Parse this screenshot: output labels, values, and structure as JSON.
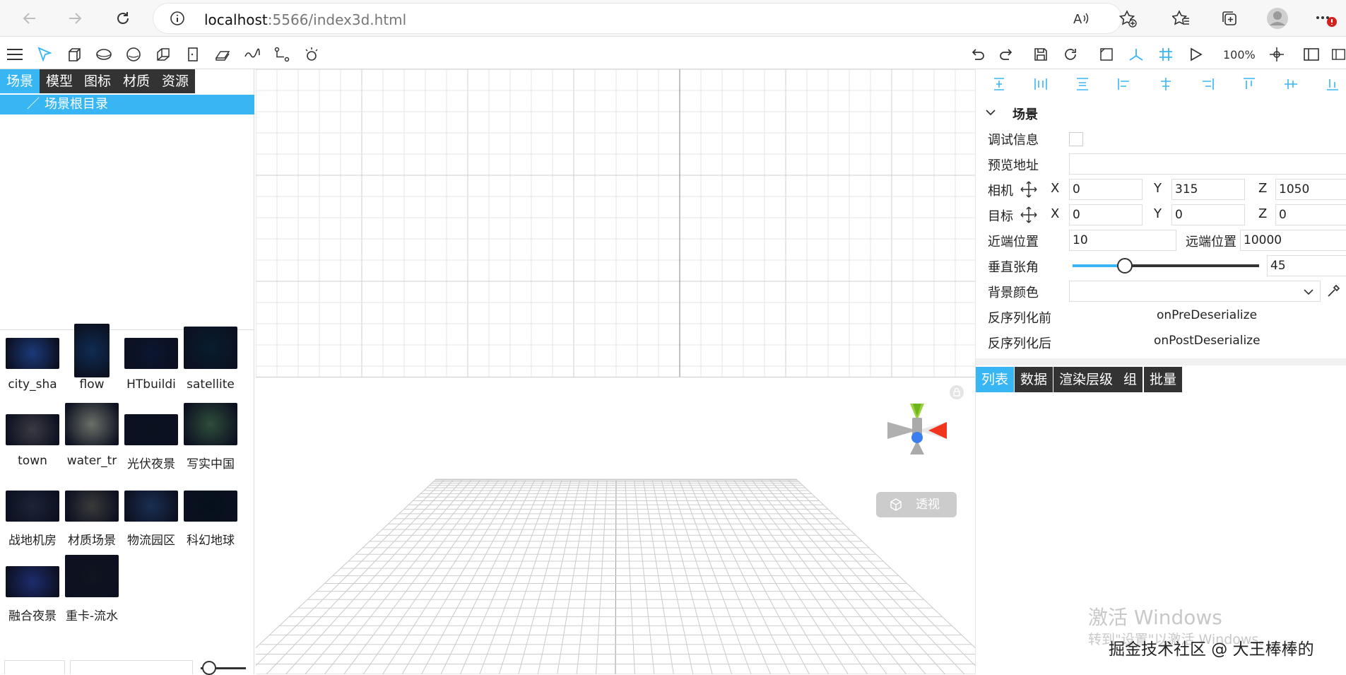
{
  "browser": {
    "url_prefix": "localhost",
    "url_rest": ":5566/index3d.html",
    "icons": [
      "back-arrow-icon",
      "forward-arrow-icon",
      "reload-icon",
      "info-icon",
      "read-aloud-icon",
      "add-favorite-icon",
      "favorites-icon",
      "collections-icon",
      "profile-avatar",
      "more-menu-icon"
    ]
  },
  "toolbar": {
    "zoom": "100%"
  },
  "left": {
    "tabs": [
      "场景",
      "模型",
      "图标",
      "材质",
      "资源"
    ],
    "tree_root": "场景根目录",
    "tree_slash": "／",
    "assets": [
      {
        "label": "city_sha",
        "color": "#1b3a7a"
      },
      {
        "label": "flow",
        "color": "#0f2c52"
      },
      {
        "label": "HTbuildi",
        "color": "#0b1630"
      },
      {
        "label": "satellite",
        "color": "#071d2e"
      },
      {
        "label": "town",
        "color": "#3a3a42"
      },
      {
        "label": "water_tr",
        "color": "#6a6f68"
      },
      {
        "label": "光伏夜景",
        "color": "#0a1220"
      },
      {
        "label": "写实中国",
        "color": "#2e4d3a"
      },
      {
        "label": "战地机房",
        "color": "#1c2436"
      },
      {
        "label": "材质场景",
        "color": "#3a3a3a"
      },
      {
        "label": "物流园区",
        "color": "#1a2f52"
      },
      {
        "label": "科幻地球",
        "color": "#05101c"
      },
      {
        "label": "融合夜景",
        "color": "#1e2c6e"
      },
      {
        "label": "重卡-流水",
        "color": "#101420"
      }
    ]
  },
  "viewport": {
    "perspective_label": "透视"
  },
  "props": {
    "section": "场景",
    "debug_label": "调试信息",
    "preview_label": "预览地址",
    "camera_label": "相机",
    "target_label": "目标",
    "axis_x": "X",
    "axis_y": "Y",
    "axis_z": "Z",
    "camera": {
      "x": "0",
      "y": "315",
      "z": "1050"
    },
    "target": {
      "x": "0",
      "y": "0",
      "z": "0"
    },
    "near_label": "近端位置",
    "near": "10",
    "far_label": "远端位置",
    "far": "10000",
    "fov_label": "垂直张角",
    "fov": "45",
    "fov_fraction": 0.28,
    "bg_label": "背景颜色",
    "pre_label": "反序列化前",
    "pre_value": "onPreDeserialize",
    "post_label": "反序列化后",
    "post_value": "onPostDeserialize"
  },
  "right_tabs": [
    "列表",
    "数据",
    "渲染层级",
    "组",
    "批量"
  ],
  "watermark": {
    "title": "激活 Windows",
    "sub": "转到\"设置\"以激活 Windows。"
  },
  "credit": "掘金技术社区 @ 大王棒棒的"
}
